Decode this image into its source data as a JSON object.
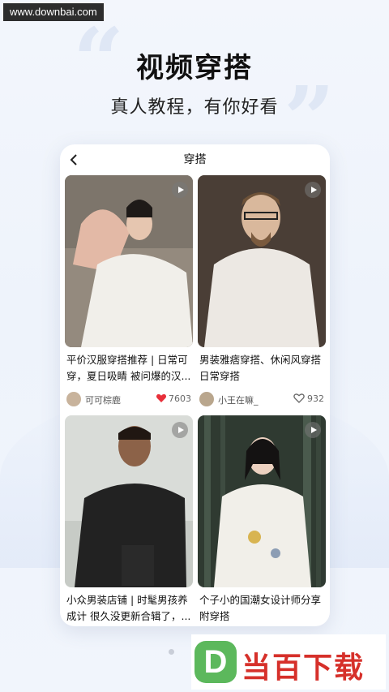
{
  "watermark": "www.downbai.com",
  "headline": "视频穿搭",
  "subline": "真人教程，有你好看",
  "screen": {
    "title": "穿搭",
    "cards": [
      {
        "title": "平价汉服穿搭推荐 | 日常可穿，夏日吸睛 被问爆的汉...",
        "author": "可可棕鹿",
        "likes": "7603",
        "liked": true
      },
      {
        "title": "男装雅痞穿搭、休闲风穿搭日常穿搭",
        "author": "小王在嘛_",
        "likes": "932",
        "liked": false
      },
      {
        "title": "小众男装店铺 | 时髦男孩养成计 很久没更新合辑了，...",
        "author": "",
        "likes": "",
        "liked": false
      },
      {
        "title": "个子小的国潮女设计师分享附穿搭",
        "author": "",
        "likes": "",
        "liked": false
      }
    ]
  },
  "logo": {
    "badge_letter": "D",
    "text": "当百下载"
  },
  "colors": {
    "like_red": "#e8303a",
    "logo_red": "#d6302a",
    "logo_green": "#5cb85c"
  }
}
